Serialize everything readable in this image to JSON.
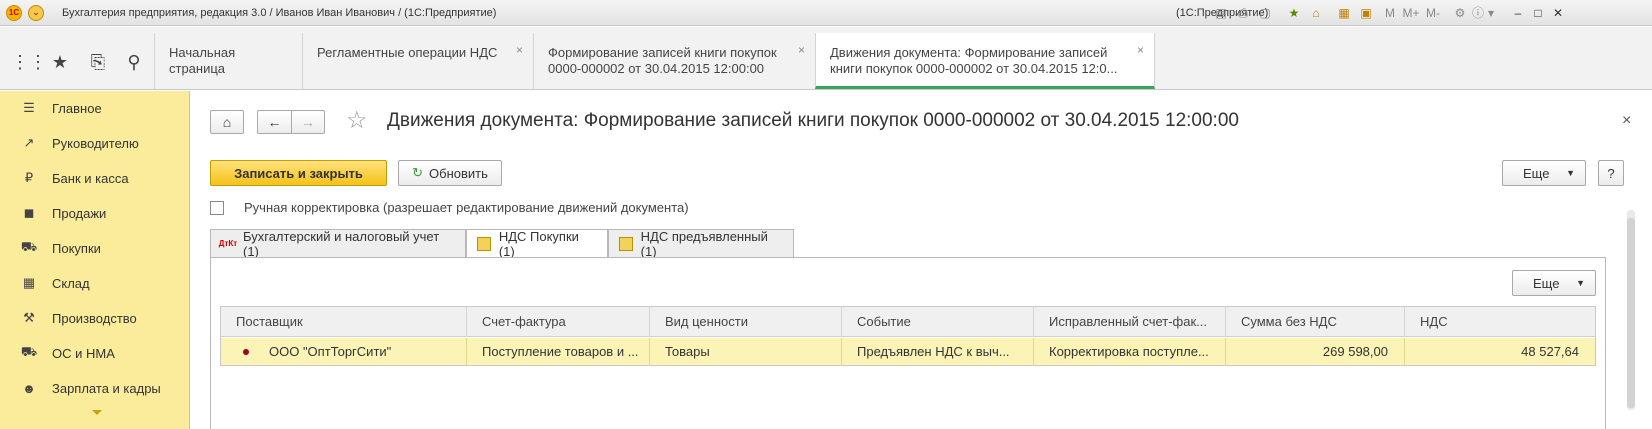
{
  "window": {
    "title": "Бухгалтерия предприятия, редакция 3.0 / Иванов Иван Иванович / (1С:Предприятие)",
    "title_right": "(1С:Предприятие)"
  },
  "titlebar_tools": [
    "M",
    "M+",
    "M-"
  ],
  "quick_icons": [
    "apps-grid-icon",
    "favorites-star-icon",
    "history-icon",
    "search-icon"
  ],
  "tabs": [
    {
      "label": "Начальная страница",
      "closable": false
    },
    {
      "label": "Регламентные операции НДС",
      "closable": true
    },
    {
      "label": "Формирование записей книги покупок 0000-000002 от 30.04.2015 12:00:00",
      "line1": "Формирование записей книги покупок",
      "line2": "0000-000002 от 30.04.2015 12:00:00",
      "closable": true
    },
    {
      "label": "Движения документа: Формирование записей книги покупок 0000-000002 от 30.04.2015 12:0...",
      "line1": "Движения документа: Формирование записей",
      "line2": "книги покупок 0000-000002 от 30.04.2015 12:0...",
      "closable": true,
      "active": true
    }
  ],
  "sidebar": {
    "items": [
      {
        "label": "Главное",
        "icon": "menu-icon"
      },
      {
        "label": "Руководителю",
        "icon": "chart-line-icon"
      },
      {
        "label": "Банк и касса",
        "icon": "ruble-icon"
      },
      {
        "label": "Продажи",
        "icon": "bag-icon"
      },
      {
        "label": "Покупки",
        "icon": "cart-icon"
      },
      {
        "label": "Склад",
        "icon": "warehouse-icon"
      },
      {
        "label": "Производство",
        "icon": "factory-icon"
      },
      {
        "label": "ОС и НМА",
        "icon": "truck-icon"
      },
      {
        "label": "Зарплата и кадры",
        "icon": "person-icon"
      }
    ]
  },
  "document": {
    "title": "Движения документа: Формирование записей книги покупок 0000-000002 от 30.04.2015 12:00:00"
  },
  "toolbar": {
    "save_close": "Записать и закрыть",
    "refresh": "Обновить",
    "more": "Еще",
    "help": "?"
  },
  "manual_edit": {
    "label": "Ручная корректировка (разрешает редактирование движений документа)",
    "checked": false
  },
  "form_tabs": [
    {
      "label": "Бухгалтерский и налоговый учет (1)",
      "icon": "dt-kt-icon"
    },
    {
      "label": "НДС Покупки (1)",
      "icon": "register-icon",
      "active": true
    },
    {
      "label": "НДС предъявленный (1)",
      "icon": "register-icon"
    }
  ],
  "grid": {
    "more": "Еще",
    "columns": [
      "Поставщик",
      "Счет-фактура",
      "Вид ценности",
      "Событие",
      "Исправленный счет-фак...",
      "Сумма без НДС",
      "НДС"
    ],
    "rows": [
      {
        "supplier": "ООО \"ОптТоргСити\"",
        "invoice": "Поступление товаров и ...",
        "value_type": "Товары",
        "event": "Предъявлен НДС к выч...",
        "corrected": "Корректировка поступле...",
        "amount": "269 598,00",
        "vat": "48 527,64"
      }
    ]
  },
  "colors": {
    "sidebar": "#fbec9b",
    "primary_button": "#f5c21a",
    "active_tab_underline": "#3aa35f",
    "selected_row": "#fcf3b7"
  }
}
